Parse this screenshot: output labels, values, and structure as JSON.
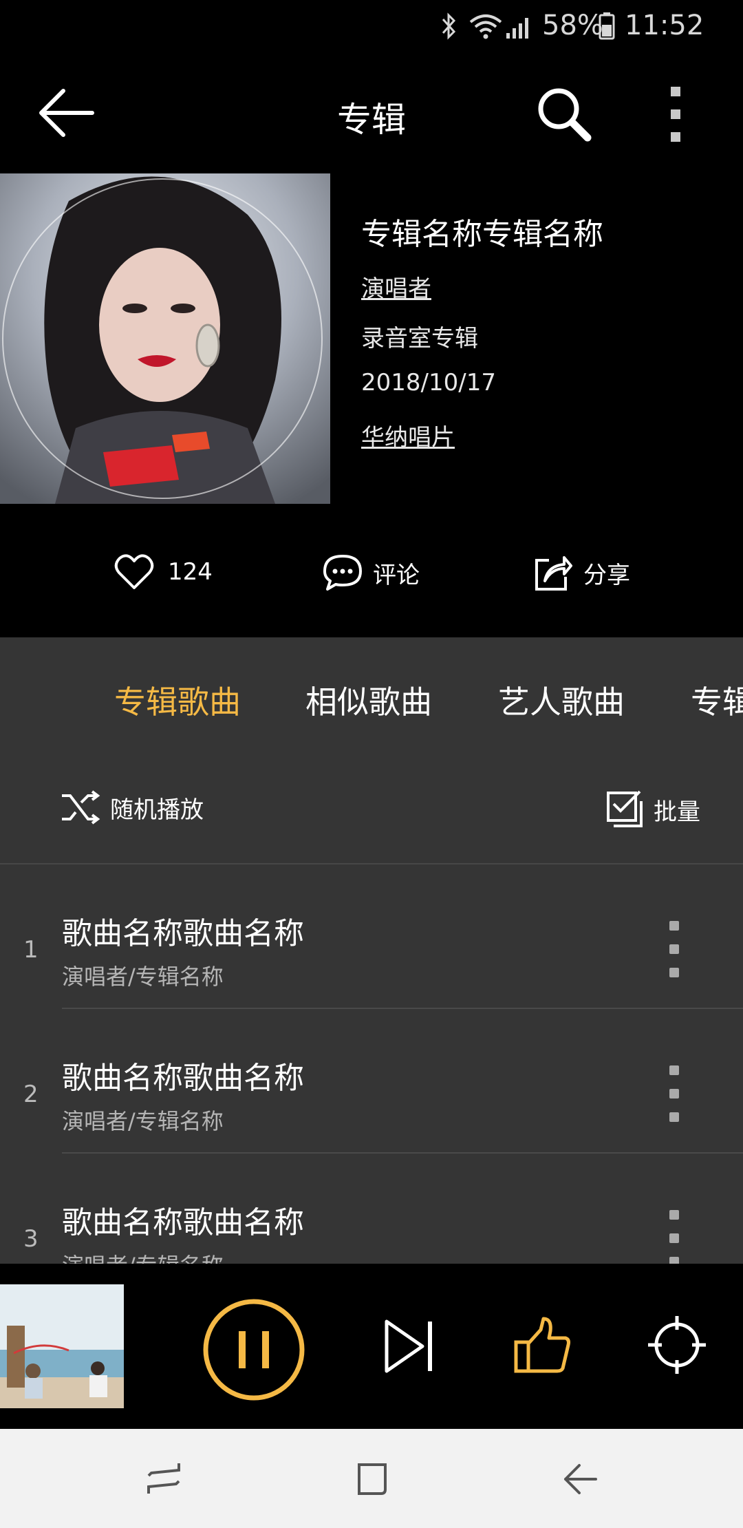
{
  "status_bar": {
    "battery_pct": "58%",
    "time": "11:52",
    "icons": [
      "bluetooth-icon",
      "wifi-icon",
      "signal-icon",
      "battery-icon"
    ]
  },
  "header": {
    "title": "专辑",
    "icons": [
      "back-arrow-icon",
      "search-icon",
      "more-vertical-icon"
    ]
  },
  "album": {
    "name": "专辑名称专辑名称",
    "artist": "演唱者",
    "type": "录音室专辑",
    "date": "2018/10/17",
    "label": "华纳唱片"
  },
  "actions": {
    "likes": "124",
    "comment": "评论",
    "share": "分享"
  },
  "tabs": [
    {
      "label": "专辑歌曲",
      "active": true
    },
    {
      "label": "相似歌曲",
      "active": false
    },
    {
      "label": "艺人歌曲",
      "active": false
    },
    {
      "label": "专辑",
      "active": false
    }
  ],
  "controls": {
    "shuffle": "随机播放",
    "batch": "批量"
  },
  "songs": [
    {
      "num": "1",
      "name": "歌曲名称歌曲名称",
      "sub": "演唱者/专辑名称"
    },
    {
      "num": "2",
      "name": "歌曲名称歌曲名称",
      "sub": "演唱者/专辑名称"
    },
    {
      "num": "3",
      "name": "歌曲名称歌曲名称",
      "sub": "演唱者/专辑名称"
    }
  ],
  "player": {
    "icons": [
      "pause-icon",
      "next-icon",
      "thumbs-up-icon",
      "locate-icon"
    ]
  },
  "colors": {
    "accent": "#f5b945",
    "background": "#000000",
    "list_bg": "#353535"
  }
}
